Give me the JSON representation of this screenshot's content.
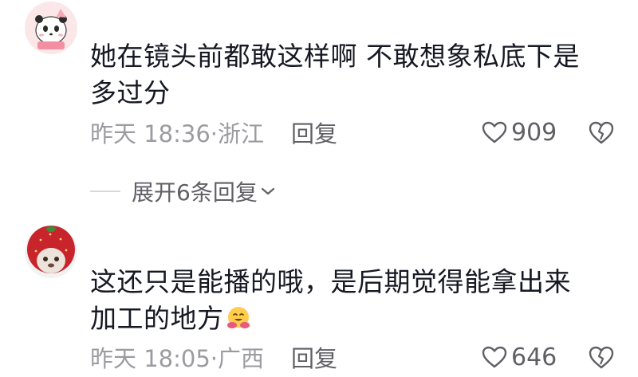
{
  "comments": [
    {
      "text_line1": "她在镜头前都敢这样啊 不敢想象私底下是",
      "text_line2": "多过分",
      "time": "昨天 18:36",
      "location": "·浙江",
      "reply_label": "回复",
      "likes": "909",
      "avatar_icon": "panda-avatar"
    },
    {
      "text_line1": "这还只是能播的哦，是后期觉得能拿出来",
      "text_line2": "加工的地方",
      "emoji": "hugging-face-emoji",
      "time": "昨天 18:05",
      "location": "·广西",
      "reply_label": "回复",
      "likes": "646",
      "avatar_icon": "strawberry-hat-avatar"
    }
  ],
  "expand_replies": {
    "label": "展开6条回复"
  },
  "colors": {
    "text": "#161823",
    "meta": "#9b9ba1",
    "action": "#5f5f66"
  }
}
